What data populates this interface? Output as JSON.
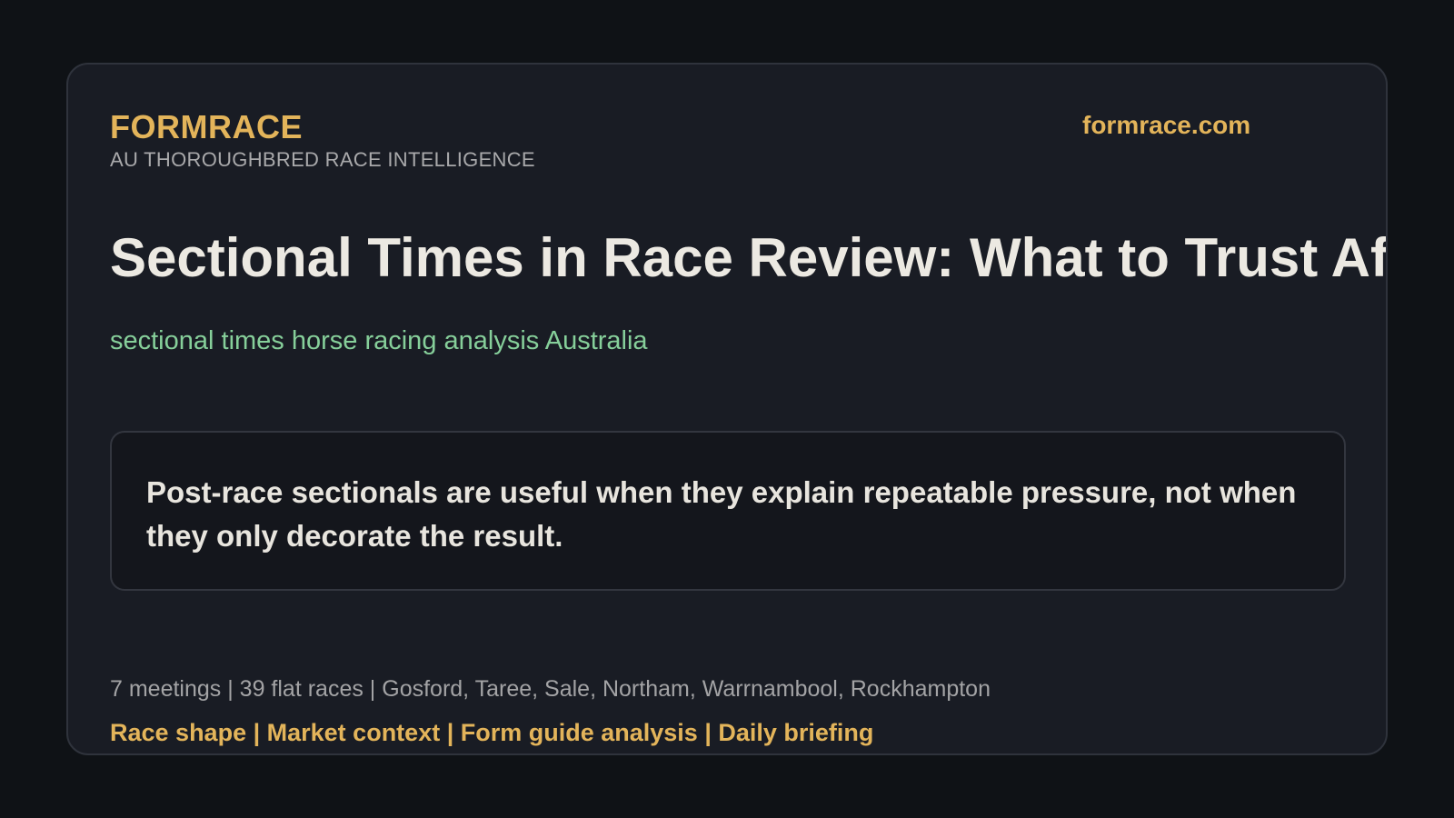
{
  "header": {
    "brand": "FORMRACE",
    "tagline": "AU THOROUGHBRED RACE INTELLIGENCE",
    "domain": "formrace.com"
  },
  "article": {
    "headline": "Sectional Times in Race Review: What to Trust After the Race",
    "keywords": "sectional times horse racing analysis Australia",
    "summary": "Post-race sectionals are useful when they explain repeatable pressure, not when they only decorate the result."
  },
  "footer": {
    "meta": "7 meetings | 39 flat races | Gosford, Taree, Sale, Northam, Warrnambool, Rockhampton",
    "sections": "Race shape | Market context | Form guide analysis | Daily briefing"
  },
  "colors": {
    "background": "#0f1216",
    "card": "#191c24",
    "accent": "#e3b45a",
    "keyword": "#86cf9a",
    "text": "#ece9e2"
  }
}
